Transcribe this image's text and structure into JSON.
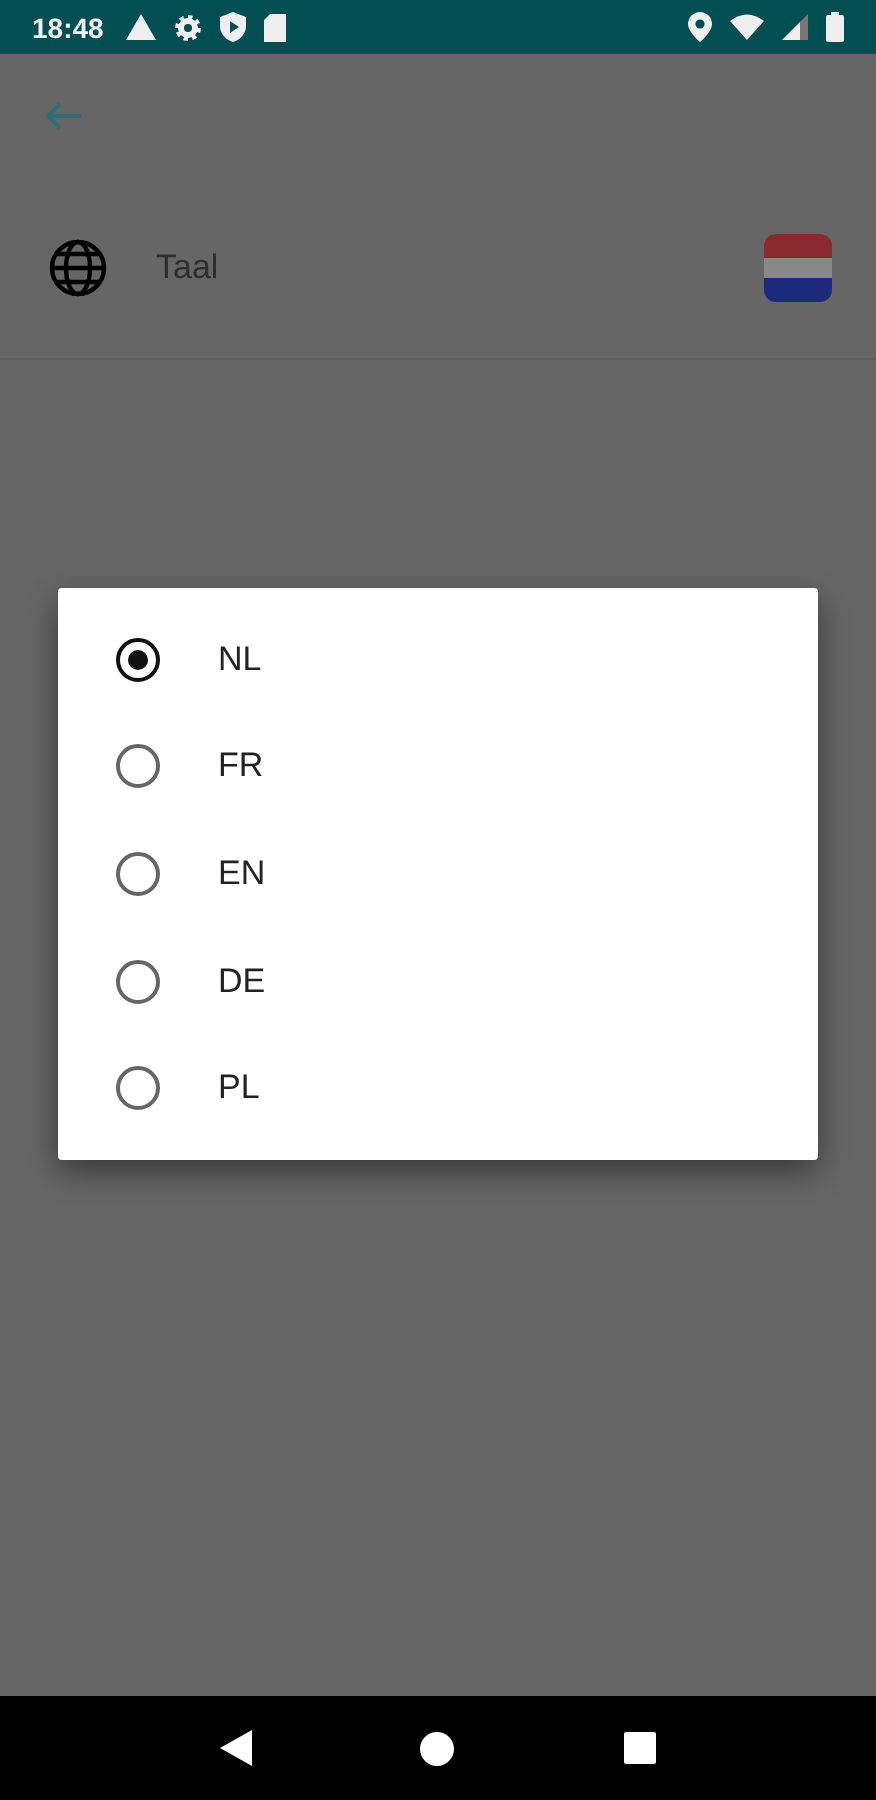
{
  "status_bar": {
    "time": "18:48"
  },
  "setting": {
    "label": "Taal"
  },
  "dialog": {
    "options": [
      {
        "label": "NL",
        "selected": true
      },
      {
        "label": "FR",
        "selected": false
      },
      {
        "label": "EN",
        "selected": false
      },
      {
        "label": "DE",
        "selected": false
      },
      {
        "label": "PL",
        "selected": false
      }
    ]
  }
}
